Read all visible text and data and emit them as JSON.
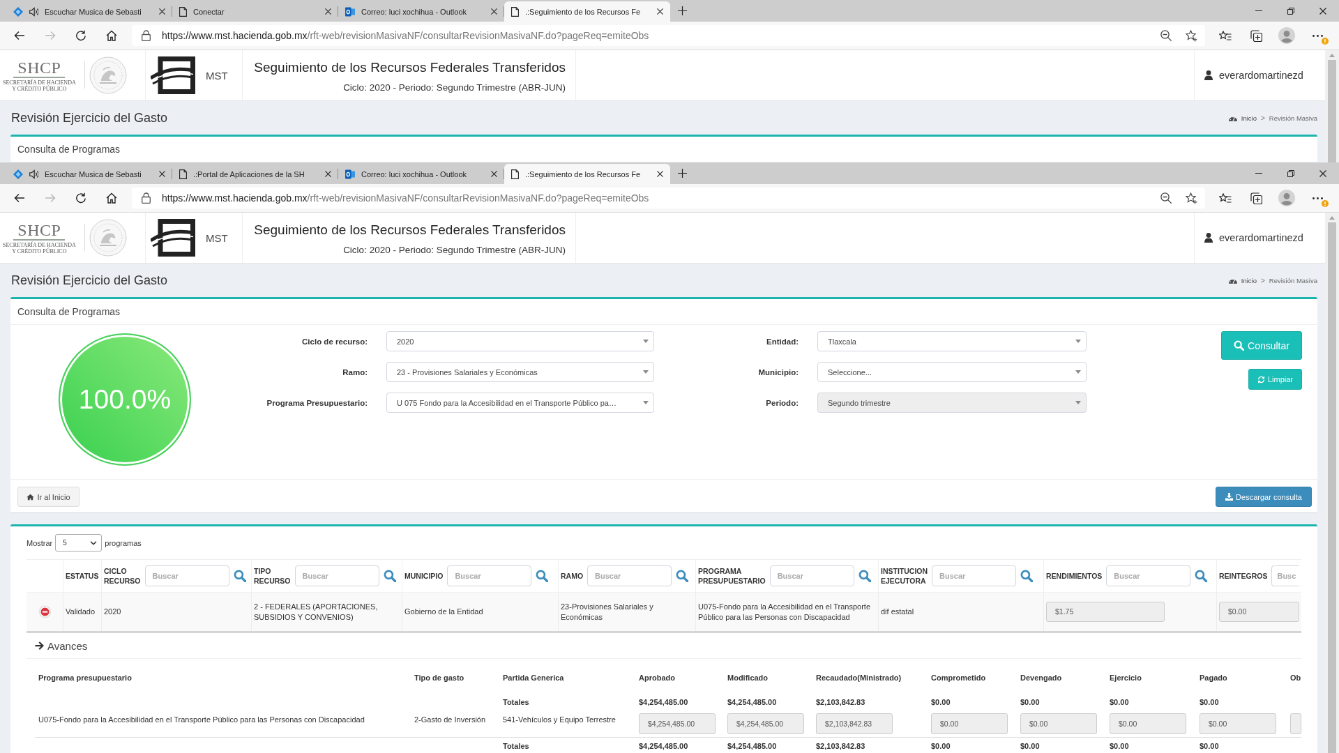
{
  "windows": [
    {
      "tabs": [
        {
          "kind": "app",
          "audio": true,
          "label": "Escuchar Musica de Sebasti",
          "selected": false
        },
        {
          "kind": "page",
          "audio": false,
          "label": "Conectar",
          "selected": false
        },
        {
          "kind": "mail",
          "audio": false,
          "label": "Correo: luci xochihua - Outlook",
          "selected": false
        },
        {
          "kind": "page",
          "audio": false,
          "label": ".:Seguimiento de los Recursos Fe",
          "selected": true
        }
      ],
      "toolbar": {
        "forward_disabled": true,
        "menu_alert": true,
        "url_host": "https://www.mst.hacienda.gob.mx",
        "url_path": "/rft-web/revisionMasivaNF/consultarRevisionMasivaNF.do?pageReq=emiteObs"
      },
      "site_header": {
        "logo_acronym": "SHCP",
        "logo_lines": [
          "SECRETARÍA DE HACIENDA",
          "Y CRÉDITO PÚBLICO"
        ],
        "brand": "MST",
        "title": "Seguimiento de los Recursos Federales Transferidos",
        "subtitle": "Ciclo: 2020 - Periodo: Segundo Trimestre (ABR-JUN)",
        "user": "everardomartinezd"
      },
      "page": {
        "title": "Revisión Ejercicio del Gasto",
        "breadcrumb": {
          "items": [
            "Inicio",
            "Revisión Masiva"
          ],
          "separator": ">"
        },
        "panel_title": "Consulta de Programas"
      }
    },
    {
      "tabs": [
        {
          "kind": "app",
          "audio": true,
          "label": "Escuchar Musica de Sebasti",
          "selected": false
        },
        {
          "kind": "page",
          "audio": false,
          "label": ".:Portal de Aplicaciones de la SH",
          "selected": false
        },
        {
          "kind": "mail",
          "audio": false,
          "label": "Correo: luci xochihua - Outlook",
          "selected": false
        },
        {
          "kind": "page",
          "audio": false,
          "label": ".:Seguimiento de los Recursos Fe",
          "selected": true
        }
      ],
      "toolbar": {
        "forward_disabled": true,
        "menu_alert": true,
        "url_host": "https://www.mst.hacienda.gob.mx",
        "url_path": "/rft-web/revisionMasivaNF/consultarRevisionMasivaNF.do?pageReq=emiteObs"
      },
      "site_header": {
        "logo_acronym": "SHCP",
        "logo_lines": [
          "SECRETARÍA DE HACIENDA",
          "Y CRÉDITO PÚBLICO"
        ],
        "brand": "MST",
        "title": "Seguimiento de los Recursos Federales Transferidos",
        "subtitle": "Ciclo: 2020 - Periodo: Segundo Trimestre (ABR-JUN)",
        "user": "everardomartinezd"
      },
      "page": {
        "title": "Revisión Ejercicio del Gasto",
        "breadcrumb": {
          "items": [
            "Inicio",
            "Revisión Masiva"
          ],
          "separator": ">"
        },
        "panel_title": "Consulta de Programas",
        "completion": "100.0%",
        "filters": {
          "left": [
            {
              "label": "Ciclo de recurso:",
              "value": "2020",
              "disabled": false
            },
            {
              "label": "Ramo:",
              "value": "23 - Provisiones Salariales y Económicas",
              "disabled": false
            },
            {
              "label": "Programa Presupuestario:",
              "value": "U 075 Fondo para la Accesibilidad en el Transporte Público pa…",
              "disabled": false
            }
          ],
          "right": [
            {
              "label": "Entidad:",
              "value": "Tlaxcala",
              "disabled": false
            },
            {
              "label": "Municipio:",
              "value": "Seleccione...",
              "disabled": false
            },
            {
              "label": "Periodo:",
              "value": "Segundo trimestre",
              "disabled": true
            }
          ]
        },
        "actions": {
          "consult": "Consultar",
          "clear": "Limpiar",
          "home": "Ir al Inicio",
          "download": "Descargar consulta"
        },
        "results": {
          "length_menu": {
            "prefix": "Mostrar",
            "value": "5",
            "suffix": "programas"
          },
          "columns": [
            {
              "label": "ESTATUS",
              "search_button": false
            },
            {
              "label": "CICLO RECURSO",
              "placeholder": "Buscar",
              "search_button": true
            },
            {
              "label": "TIPO RECURSO",
              "placeholder": "Buscar",
              "search_button": true
            },
            {
              "label": "MUNICIPIO",
              "placeholder": "Buscar",
              "search_button": true
            },
            {
              "label": "RAMO",
              "placeholder": "Buscar",
              "search_button": true
            },
            {
              "label": "PROGRAMA PRESUPUESTARIO",
              "placeholder": "Buscar",
              "search_button": true
            },
            {
              "label": "INSTITUCION EJECUTORA",
              "placeholder": "Buscar",
              "search_button": true
            },
            {
              "label": "RENDIMIENTOS",
              "placeholder": "Buscar",
              "search_button": true
            },
            {
              "label": "REINTEGROS",
              "placeholder": "Busc",
              "search_button": false
            }
          ],
          "rows": [
            {
              "expanded": true,
              "cells": [
                {
                  "kind": "text",
                  "value": "Validado"
                },
                {
                  "kind": "text",
                  "value": "2020"
                },
                {
                  "kind": "text",
                  "value": "2 - FEDERALES (APORTACIONES, SUBSIDIOS Y CONVENIOS)"
                },
                {
                  "kind": "text",
                  "value": "Gobierno de la Entidad"
                },
                {
                  "kind": "text",
                  "value": "23-Provisiones Salariales y Económicas"
                },
                {
                  "kind": "text",
                  "value": "U075-Fondo para la Accesibilidad en el Transporte Público para las Personas con Discapacidad"
                },
                {
                  "kind": "text",
                  "value": "dif estatal"
                },
                {
                  "kind": "field",
                  "value": "$1.75"
                },
                {
                  "kind": "field",
                  "value": "$0.00"
                }
              ]
            }
          ],
          "detail": {
            "title": "Avances",
            "columns": [
              "Programa presupuestario",
              "Tipo de gasto",
              "Partida Generica",
              "Aprobado",
              "Modificado",
              "Recaudado(Ministrado)",
              "Comprometido",
              "Devengado",
              "Ejercicio",
              "Pagado",
              "Ob"
            ],
            "rows": [
              {
                "kind": "totals",
                "label": "Totales",
                "amounts": [
                  "$4,254,485.00",
                  "$4,254,485.00",
                  "$2,103,842.83",
                  "$0.00",
                  "$0.00",
                  "$0.00",
                  "$0.00"
                ]
              },
              {
                "kind": "item",
                "program": "U075-Fondo para la Accesibilidad en el Transporte Público para las Personas con Discapacidad",
                "expense_type": "2-Gasto de Inversión",
                "item": "541-Vehículos y Equipo Terrestre",
                "amounts": [
                  "$4,254,485.00",
                  "$4,254,485.00",
                  "$2,103,842.83",
                  "$0.00",
                  "$0.00",
                  "$0.00",
                  "$0.00"
                ]
              },
              {
                "kind": "totals",
                "label": "Totales",
                "amounts": [
                  "$4,254,485.00",
                  "$4,254,485.00",
                  "$2,103,842.83",
                  "$0.00",
                  "$0.00",
                  "$0.00",
                  "$0.00"
                ]
              }
            ]
          }
        }
      }
    }
  ]
}
